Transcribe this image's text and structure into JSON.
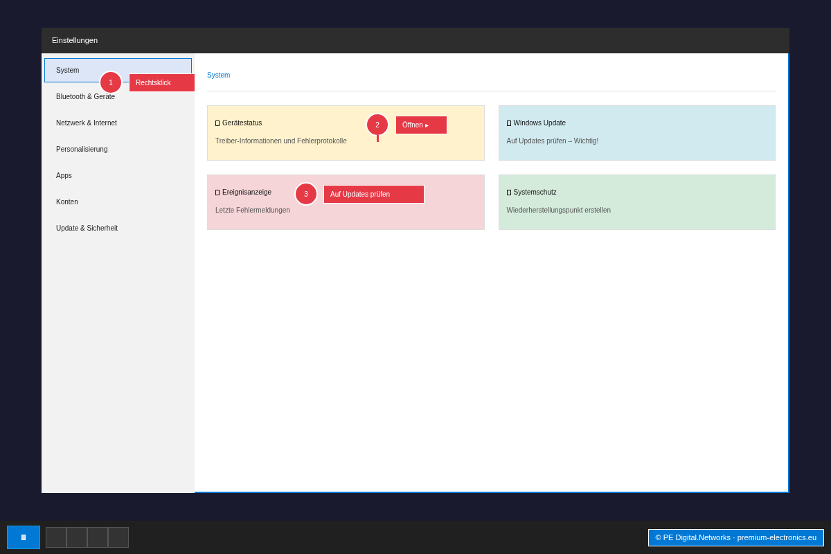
{
  "window": {
    "title": "Einstellungen"
  },
  "sidebar": {
    "items": [
      {
        "label": "System",
        "selected": true
      },
      {
        "label": "Bluetooth & Geräte",
        "selected": false
      },
      {
        "label": "Netzwerk & Internet",
        "selected": false
      },
      {
        "label": "Personalisierung",
        "selected": false
      },
      {
        "label": "Apps",
        "selected": false
      },
      {
        "label": "Konten",
        "selected": false
      },
      {
        "label": "Update & Sicherheit",
        "selected": false
      }
    ]
  },
  "breadcrumb": "System",
  "cards": [
    {
      "title": "Gerätestatus",
      "description": "Treiber-Informationen und Fehlerprotokolle",
      "color": "#fff2cc"
    },
    {
      "title": "Windows Update",
      "description": "Auf Updates prüfen – Wichtig!",
      "color": "#d1eaf0"
    },
    {
      "title": "Ereignisanzeige",
      "description": "Letzte Fehlermeldungen",
      "color": "#f5d5d8"
    },
    {
      "title": "Systemschutz",
      "description": "Wiederherstellungspunkt erstellen",
      "color": "#d4ebdb"
    }
  ],
  "callouts": [
    {
      "number": "1",
      "label": "Rechtsklick"
    },
    {
      "number": "2",
      "label": "Öffnen ▸"
    },
    {
      "number": "3",
      "label": "Auf Updates prüfen"
    }
  ],
  "taskbar": {
    "footer": "© PE Digital.Networks · premium-electronics.eu"
  }
}
